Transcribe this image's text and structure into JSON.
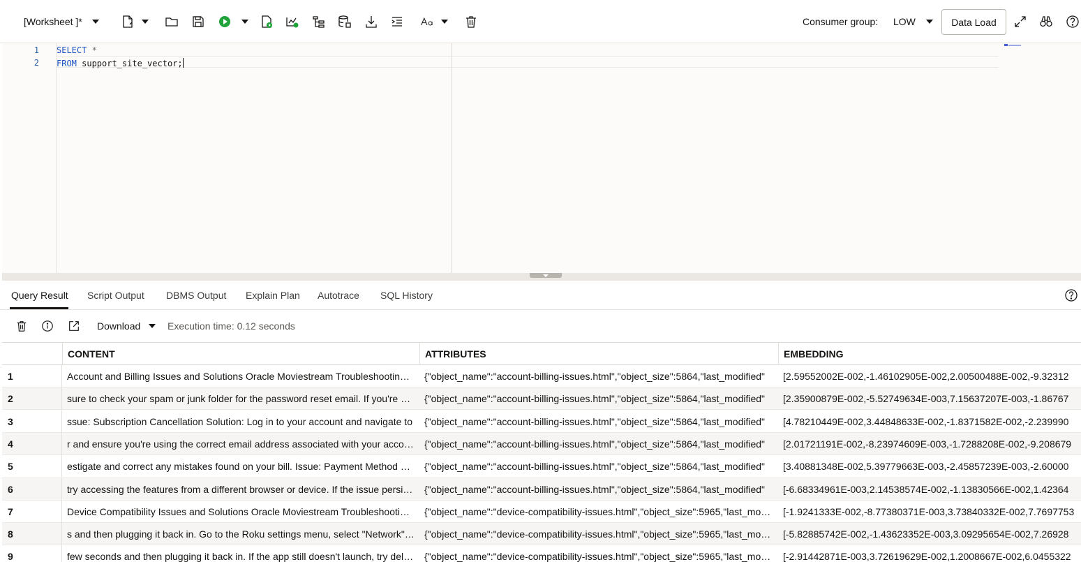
{
  "toolbar": {
    "worksheet_label": "[Worksheet ]*",
    "consumer_group_label": "Consumer group:",
    "consumer_group_value": "LOW",
    "data_load_label": "Data Load"
  },
  "editor": {
    "line_numbers": [
      "1",
      "2"
    ],
    "line1_keyword": "SELECT",
    "line1_rest": " *",
    "line2_keyword": "FROM",
    "line2_rest": " support_site_vector;"
  },
  "tabs": [
    {
      "label": "Query Result"
    },
    {
      "label": "Script Output"
    },
    {
      "label": "DBMS Output"
    },
    {
      "label": "Explain Plan"
    },
    {
      "label": "Autotrace"
    },
    {
      "label": "SQL History"
    }
  ],
  "result_toolbar": {
    "download_label": "Download",
    "execution_time": "Execution time: 0.12 seconds"
  },
  "grid": {
    "columns": [
      "CONTENT",
      "ATTRIBUTES",
      "EMBEDDING"
    ],
    "rows": [
      {
        "n": "1",
        "content": "Account and Billing Issues and Solutions Oracle Moviestream Troubleshooting Guide",
        "attributes": "{\"object_name\":\"account-billing-issues.html\",\"object_size\":5864,\"last_modified\"",
        "embedding": "[2.59552002E-002,-1.46102905E-002,2.00500488E-002,-9.32312"
      },
      {
        "n": "2",
        "content": "sure to check your spam or junk folder for the password reset email. If you're still",
        "attributes": "{\"object_name\":\"account-billing-issues.html\",\"object_size\":5864,\"last_modified\"",
        "embedding": "[2.35900879E-002,-5.52749634E-003,7.15637207E-003,-1.86767"
      },
      {
        "n": "3",
        "content": "ssue: Subscription Cancellation Solution: Log in to your account and navigate to",
        "attributes": "{\"object_name\":\"account-billing-issues.html\",\"object_size\":5864,\"last_modified\"",
        "embedding": "[4.78210449E-002,3.44848633E-002,-1.8371582E-002,-2.239990"
      },
      {
        "n": "4",
        "content": "r and ensure you're using the correct email address associated with your account",
        "attributes": "{\"object_name\":\"account-billing-issues.html\",\"object_size\":5864,\"last_modified\"",
        "embedding": "[2.01721191E-002,-8.23974609E-003,-1.7288208E-002,-9.208679"
      },
      {
        "n": "5",
        "content": "estigate and correct any mistakes found on your bill. Issue: Payment Method Update",
        "attributes": "{\"object_name\":\"account-billing-issues.html\",\"object_size\":5864,\"last_modified\"",
        "embedding": "[3.40881348E-002,5.39779663E-003,-2.45857239E-003,-2.60000"
      },
      {
        "n": "6",
        "content": "try accessing the features from a different browser or device. If the issue persists",
        "attributes": "{\"object_name\":\"account-billing-issues.html\",\"object_size\":5864,\"last_modified\"",
        "embedding": "[-6.68334961E-003,2.14538574E-002,-1.13830566E-002,1.42364"
      },
      {
        "n": "7",
        "content": "Device Compatibility Issues and Solutions Oracle Moviestream Troubleshooting Guide",
        "attributes": "{\"object_name\":\"device-compatibility-issues.html\",\"object_size\":5965,\"last_modified\"",
        "embedding": "[-1.9241333E-002,-8.77380371E-003,3.73840332E-002,7.7697753"
      },
      {
        "n": "8",
        "content": "s and then plugging it back in. Go to the Roku settings menu, select \"Network\" and",
        "attributes": "{\"object_name\":\"device-compatibility-issues.html\",\"object_size\":5965,\"last_modified\"",
        "embedding": "[-5.82885742E-002,-1.43623352E-003,3.09295654E-002,7.26928"
      },
      {
        "n": "9",
        "content": "few seconds and then plugging it back in. If the app still doesn't launch, try deleting",
        "attributes": "{\"object_name\":\"device-compatibility-issues.html\",\"object_size\":5965,\"last_modified\"",
        "embedding": "[-2.91442871E-003,3.72619629E-002,1.2008667E-002,6.0455322"
      }
    ]
  }
}
